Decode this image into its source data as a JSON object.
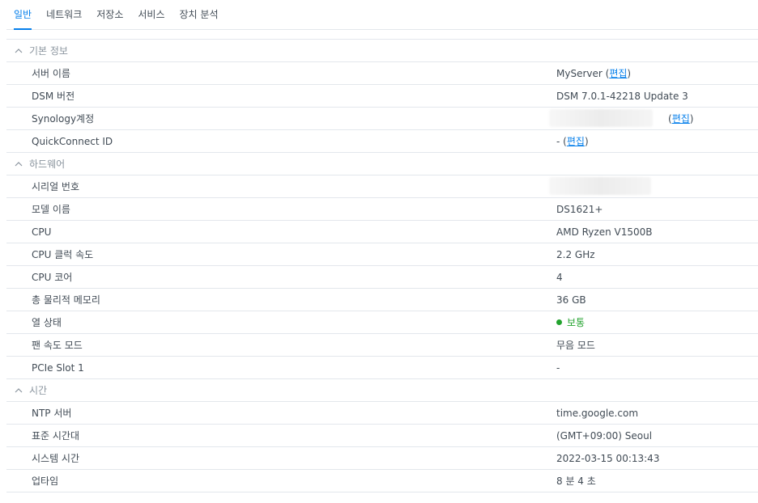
{
  "tabs": [
    "일반",
    "네트워크",
    "저장소",
    "서비스",
    "장치 분석"
  ],
  "active_tab": 0,
  "colors": {
    "accent": "#057feb",
    "status_ok": "#23a32e"
  },
  "sections": {
    "basic": {
      "title": "기본 정보",
      "rows": {
        "server_name": {
          "label": "서버 이름",
          "value": "MyServer",
          "edit": "편집"
        },
        "dsm_version": {
          "label": "DSM 버전",
          "value": "DSM 7.0.1-42218 Update 3"
        },
        "synology_account": {
          "label": "Synology계정",
          "edit": "편집"
        },
        "quickconnect": {
          "label": "QuickConnect ID",
          "value": "-",
          "edit": "편집"
        }
      }
    },
    "hardware": {
      "title": "하드웨어",
      "rows": {
        "serial": {
          "label": "시리얼 번호"
        },
        "model": {
          "label": "모델 이름",
          "value": "DS1621+"
        },
        "cpu": {
          "label": "CPU",
          "value": "AMD Ryzen V1500B"
        },
        "cpu_clock": {
          "label": "CPU 클럭 속도",
          "value": "2.2 GHz"
        },
        "cpu_cores": {
          "label": "CPU 코어",
          "value": "4"
        },
        "memory": {
          "label": "총 물리적 메모리",
          "value": "36 GB"
        },
        "thermal": {
          "label": "열 상태",
          "value": "보통"
        },
        "fan": {
          "label": "팬 속도 모드",
          "value": "무음 모드"
        },
        "pcie": {
          "label": "PCIe Slot 1",
          "value": "-"
        }
      }
    },
    "time": {
      "title": "시간",
      "rows": {
        "ntp": {
          "label": "NTP 서버",
          "value": "time.google.com"
        },
        "timezone": {
          "label": "표준 시간대",
          "value": "(GMT+09:00) Seoul"
        },
        "system_time": {
          "label": "시스템 시간",
          "value": "2022-03-15 00:13:43"
        },
        "uptime": {
          "label": "업타임",
          "value": "8 분 4 초"
        }
      }
    }
  }
}
